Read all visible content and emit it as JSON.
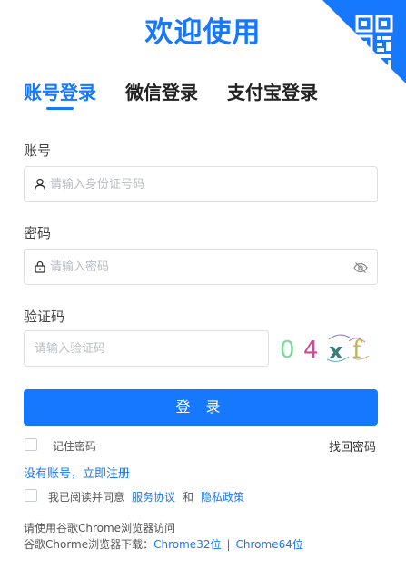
{
  "title": "欢迎使用",
  "tabs": [
    {
      "label": "账号登录",
      "active": true
    },
    {
      "label": "微信登录",
      "active": false
    },
    {
      "label": "支付宝登录",
      "active": false
    }
  ],
  "account": {
    "label": "账号",
    "placeholder": "请输入身份证号码",
    "icon": "user-icon"
  },
  "password": {
    "label": "密码",
    "placeholder": "请输入密码",
    "icon": "lock-icon",
    "toggle_icon": "eye-off-icon"
  },
  "captcha": {
    "label": "验证码",
    "placeholder": "请输入验证码",
    "code_chars": [
      "0",
      "4",
      "x",
      "f"
    ],
    "code_colors": [
      "#7fd89a",
      "#cc4b9b",
      "#3f7d7a",
      "#c9b33a"
    ]
  },
  "login_button": "登 录",
  "remember_label": "记住密码",
  "forgot_link": "找回密码",
  "register_link": "没有账号，立即注册",
  "agreement": {
    "prefix": "我已阅读并同意",
    "service_link": "服务协议",
    "and": "和",
    "privacy_link": "隐私政策"
  },
  "browser_note": "请使用谷歌Chrome浏览器访问",
  "download": {
    "prefix": "谷歌Chorme浏览器下载：",
    "link32": "Chrome32位",
    "separator": "|",
    "link64": "Chrome64位"
  },
  "colors": {
    "accent": "#1677ff",
    "border": "#dcdfe6",
    "placeholder": "#b8bcc4"
  }
}
